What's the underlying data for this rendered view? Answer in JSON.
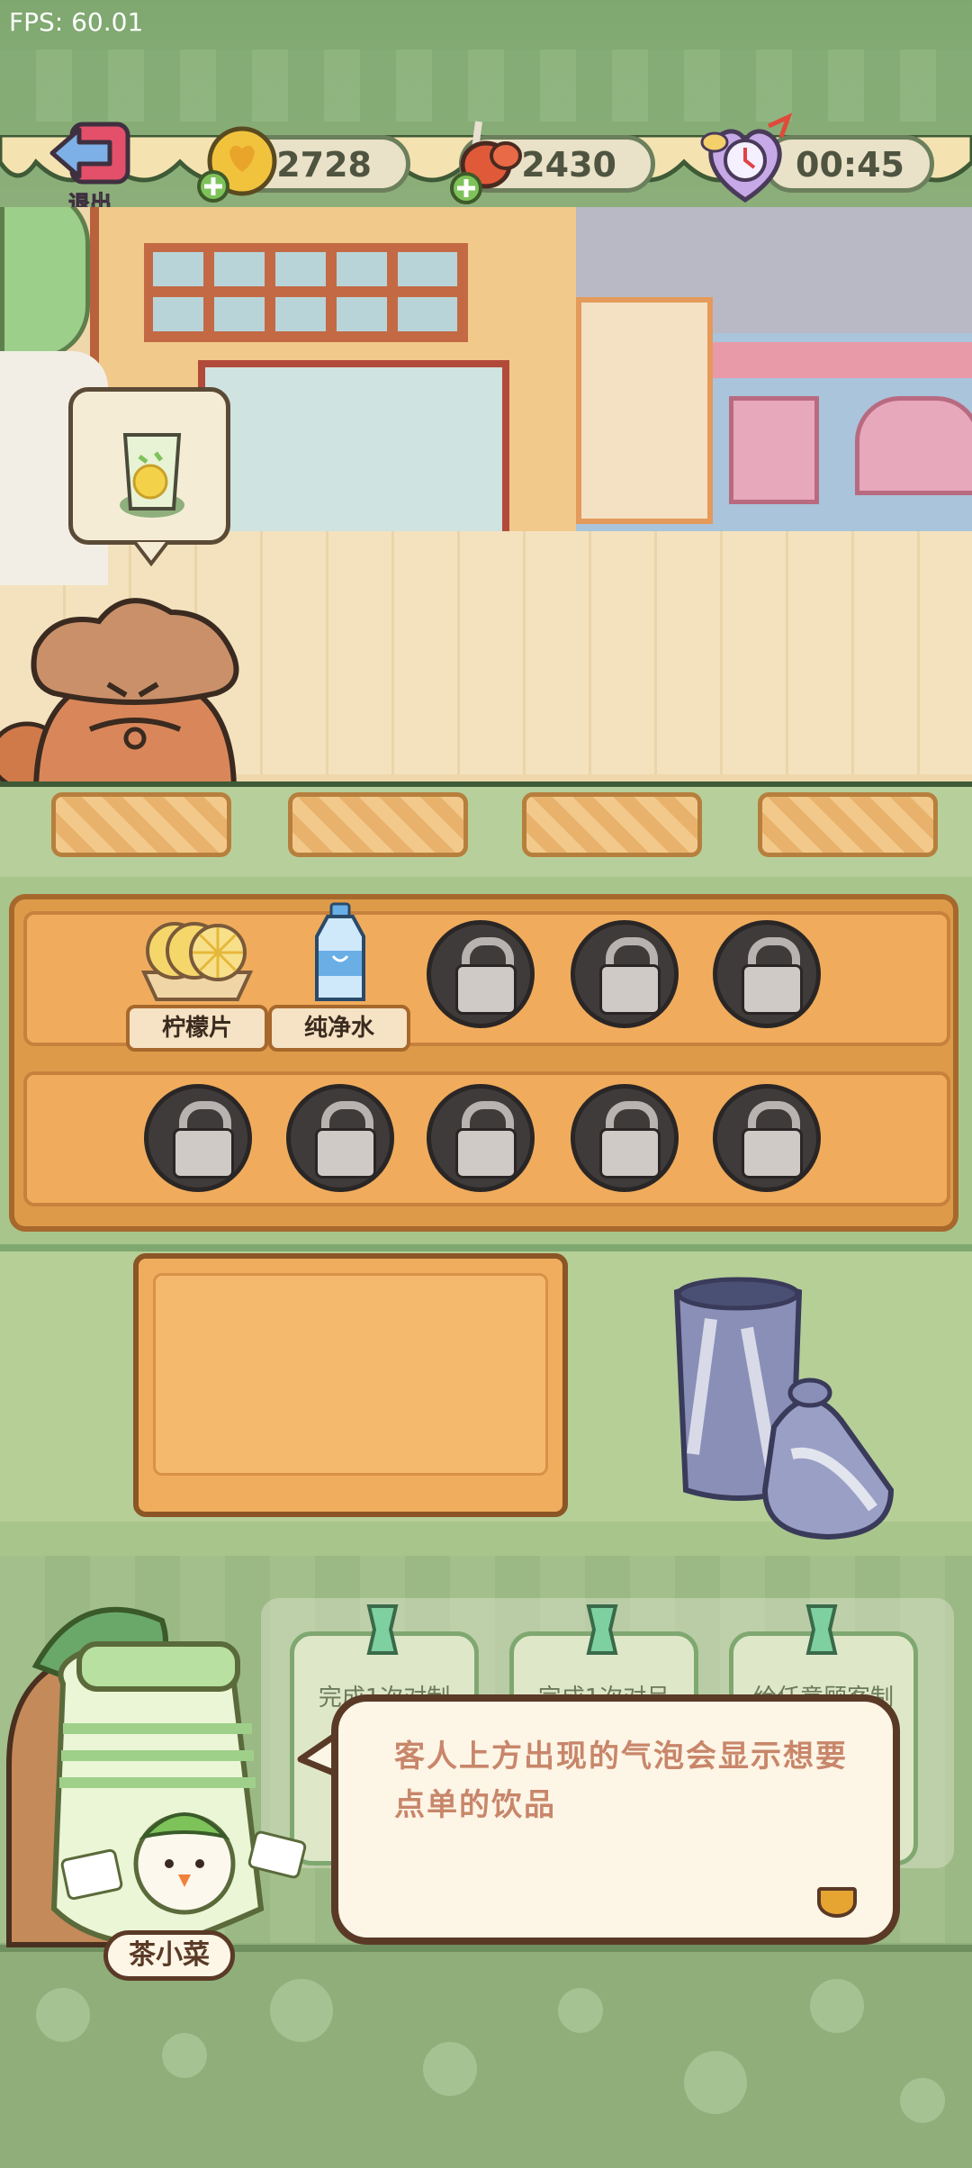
{
  "fps": "FPS: 60.01",
  "topbar": {
    "exit_label": "退出",
    "coins": "2728",
    "meat": "2430",
    "timer": "00:45"
  },
  "order_bubble": {
    "item_icon": "lemon-water-icon"
  },
  "ingredients": {
    "items": [
      {
        "label": "柠檬片",
        "icon": "lemon-slices-icon"
      },
      {
        "label": "纯净水",
        "icon": "water-bottle-icon"
      }
    ],
    "locked_icon": "lock-icon"
  },
  "tasks": [
    {
      "text": "完成1次对制"
    },
    {
      "text": "完成1次对呈"
    },
    {
      "text": "给任意顾客制"
    }
  ],
  "dialog": {
    "text": "客人上方出现的气泡会显示想要点单的饮品",
    "speaker": "茶小菜"
  },
  "colors": {
    "accent": "#5a3a26",
    "coin": "#e8b83a"
  }
}
